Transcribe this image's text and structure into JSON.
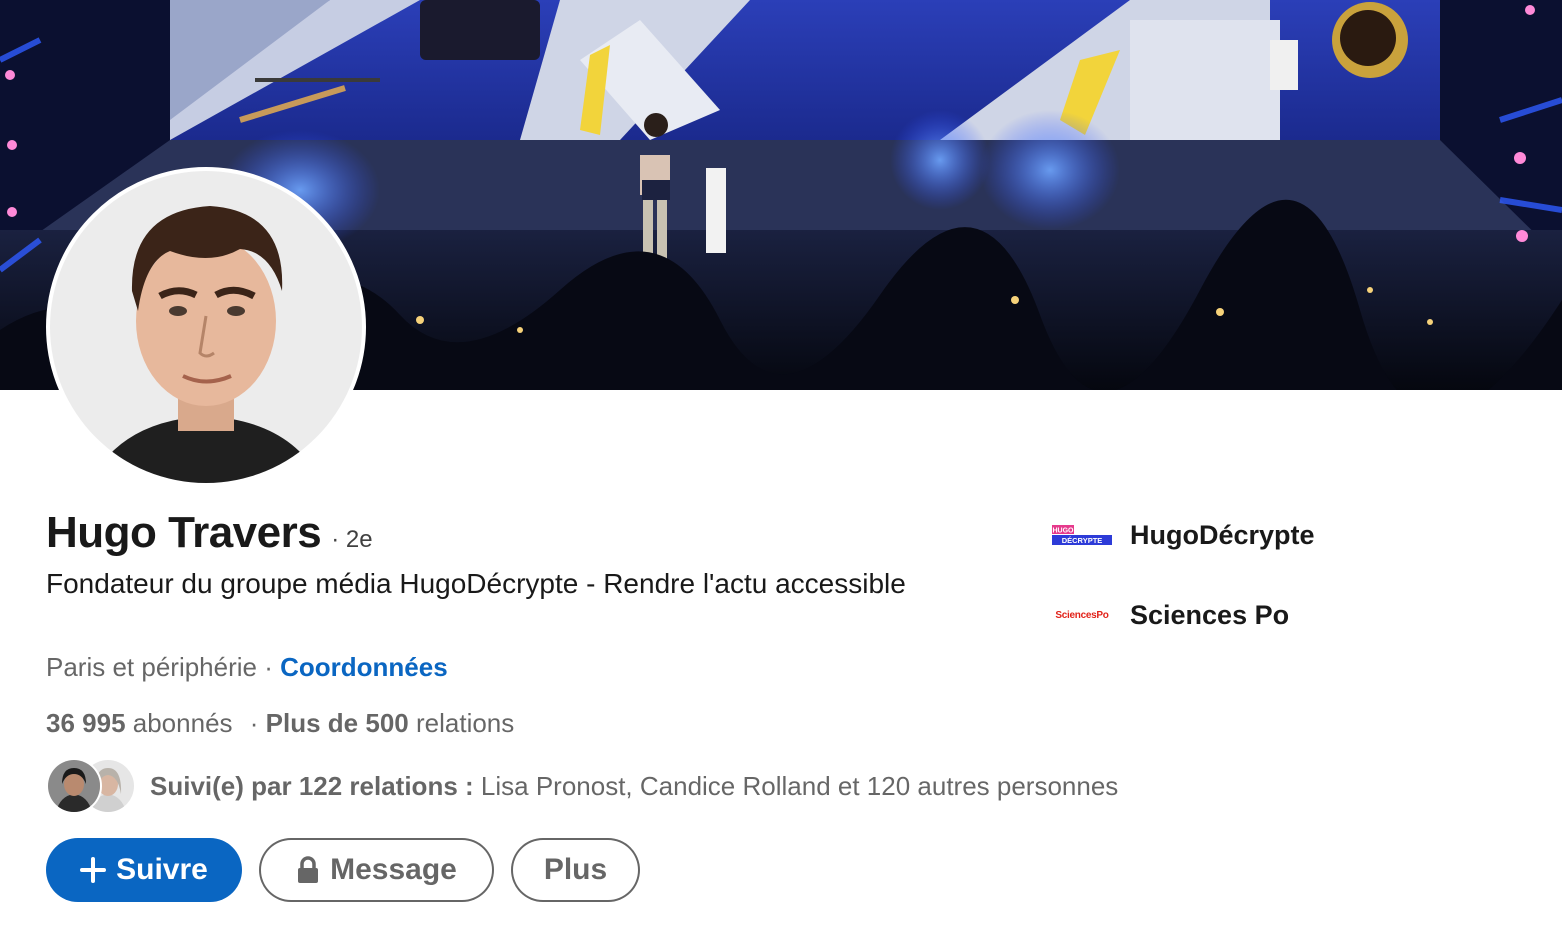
{
  "profile": {
    "name": "Hugo Travers",
    "degree": "· 2e",
    "headline": "Fondateur du groupe média HugoDécrypte - Rendre l'actu accessible",
    "location": "Paris et périphérie ·",
    "contact_link": "Coordonnées",
    "followers_count": "36 995",
    "followers_label": "abonnés",
    "connections_sep": "·",
    "connections_count": "Plus de 500",
    "connections_label": "relations",
    "mutual_bold": "Suivi(e) par 122 relations :",
    "mutual_rest": "Lisa Pronost, Candice Rolland et 120 autres personnes"
  },
  "actions": {
    "follow_label": "Suivre",
    "message_label": "Message",
    "more_label": "Plus"
  },
  "experience": [
    {
      "label": "HugoDécrypte",
      "logo_text_top": "HUGO",
      "logo_text_bottom": "DÉCRYPTE"
    },
    {
      "label": "Sciences Po",
      "logo_text": "SciencesPo"
    }
  ],
  "icons": {
    "follow": "plus-icon",
    "message": "lock-icon"
  },
  "colors": {
    "accent": "#0a66c2",
    "sciencespo_red": "#e2231a",
    "hugo_logo_blue": "#2d3bd8",
    "hugo_logo_pink": "#e63a8c"
  }
}
